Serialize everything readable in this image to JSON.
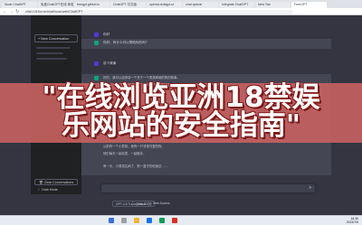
{
  "browser": {
    "tabs": [
      {
        "title": "Node ChatGPT"
      },
      {
        "title": "免费ChatGPT在线 体验"
      },
      {
        "title": "freegpt.github.io"
      },
      {
        "title": "ChatGPT 中文版"
      },
      {
        "title": "openai-chatgpt-ui"
      },
      {
        "title": "chat openai"
      },
      {
        "title": "Integrate ChatGPT"
      },
      {
        "title": "New Tab"
      },
      {
        "title": "FreeGPT"
      }
    ],
    "url": "chat.1016ui.cn/chat/local-web/ChatGPT"
  },
  "sidebar": {
    "new_conversation": "New Conversation",
    "clear_conversations": "Clear Conversations",
    "dark_mode": "Dark Mode"
  },
  "messages": [
    {
      "role": "user",
      "text": "你好"
    },
    {
      "role": "assistant",
      "text": "你好，有什么可以帮助你的吗？"
    },
    {
      "role": "user",
      "text": "讲个故事"
    }
  ],
  "response_paragraphs": [
    "好的，我可以给你讲一个关于一个男孩和他的狗的故事。",
    "从前有一个小男孩，他有一只非常可爱的狗。",
    "他们每天一起玩耍，一起散步。",
    "有一天，小男孩生病了，狗一直守在他身边……"
  ],
  "input": {
    "send_icon": "send-icon"
  },
  "footer": {
    "model": "GPT-3.5 Turbo (16k 2023)",
    "mode": "Default",
    "web_access": "Web Access"
  },
  "banner": {
    "line1": "\"在线浏览亚洲18禁娱",
    "line2": "乐网站的安全指南\""
  },
  "taskbar": {
    "time": "16:36",
    "date": "2023/7/5"
  },
  "colors": {
    "app_bg": "#343541",
    "sidebar_bg": "#202123",
    "banner": "#c46060",
    "user_avatar": "#5436da",
    "bot_avatar": "#10a37f"
  }
}
